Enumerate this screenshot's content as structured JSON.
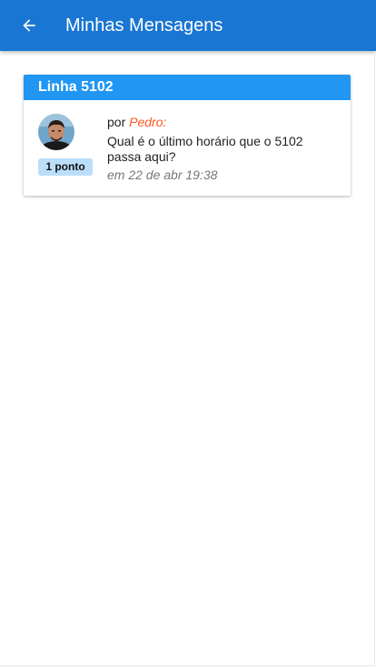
{
  "appbar": {
    "title": "Minhas Mensagens",
    "back_icon": "arrow-left-icon",
    "color": "#1976d2"
  },
  "card": {
    "header": "Linha 5102",
    "header_color": "#2196f3",
    "avatar_icon": "user-avatar",
    "points": "1 ponto",
    "by_label": "por",
    "author": "Pedro:",
    "message": "Qual é o último horário que o 5102 passa aqui?",
    "date": "em 22 de abr 19:38"
  }
}
